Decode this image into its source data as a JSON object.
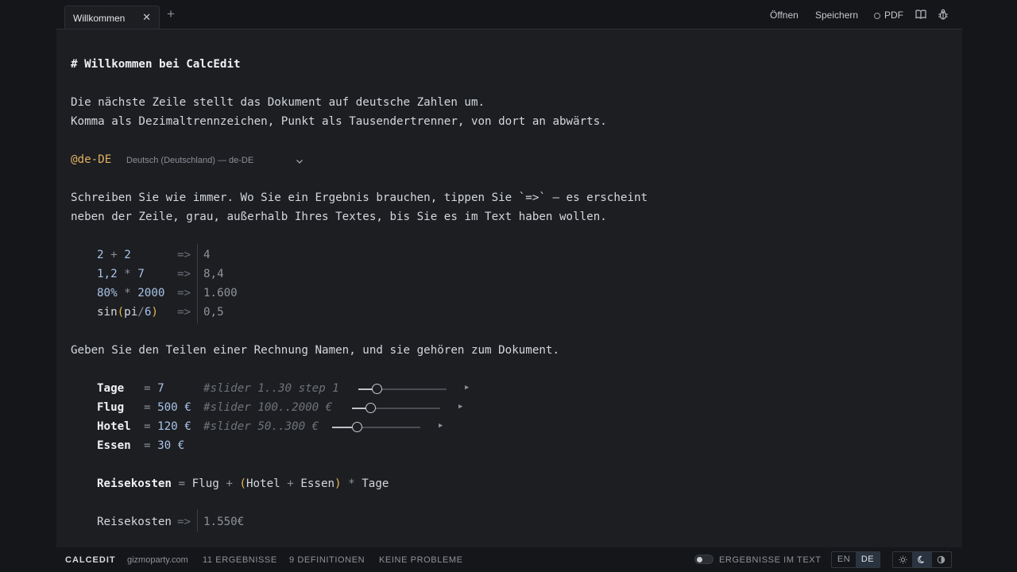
{
  "tabs": [
    {
      "label": "Willkommen",
      "active": true
    }
  ],
  "toolbar": {
    "open_label": "Öffnen",
    "save_label": "Speichern",
    "pdf_label": "PDF"
  },
  "doc": {
    "heading": "# Willkommen bei CalcEdit",
    "intro_line1": "Die nächste Zeile stellt das Dokument auf deutsche Zahlen um.",
    "intro_line2": "Komma als Dezimaltrennzeichen, Punkt als Tausendertrenner, von dort an abwärts.",
    "locale_tag": "@de-DE",
    "locale_label": "Deutsch (Deutschland) — de-DE",
    "write_line1": "Schreiben Sie wie immer. Wo Sie ein Ergebnis brauchen, tippen Sie `=>` — es erscheint",
    "write_line2": "neben der Zeile, grau, außerhalb Ihres Textes, bis Sie es im Text haben wollen.",
    "arrow": "=>",
    "calc": [
      {
        "a": "2",
        "op": "+",
        "b": "2",
        "result": "4"
      },
      {
        "a": "1,2",
        "op": "*",
        "b": "7",
        "result": "8,4"
      },
      {
        "a": "80%",
        "op": "*",
        "b": "2000",
        "result": "1.600"
      },
      {
        "fn": "sin",
        "arg1": "pi",
        "op": "/",
        "arg2": "6",
        "result": "0,5"
      }
    ],
    "names_line": "Geben Sie den Teilen einer Rechnung Namen, und sie gehören zum Dokument.",
    "defs": [
      {
        "name": "Tage",
        "value": "7",
        "comment": "#slider 1..30 step 1",
        "slider_fraction": 0.21
      },
      {
        "name": "Flug",
        "value": "500 €",
        "comment": "#slider 100..2000 €",
        "slider_fraction": 0.21
      },
      {
        "name": "Hotel",
        "value": "120 €",
        "comment": "#slider 50..300 €",
        "slider_fraction": 0.28
      },
      {
        "name": "Essen",
        "value": "30 €"
      }
    ],
    "formula": {
      "name": "Reisekosten",
      "eq": "=",
      "t1": "Flug",
      "plus1": "+",
      "open": "(",
      "t2": "Hotel",
      "plus2": "+",
      "t3": "Essen",
      "close": ")",
      "times": "*",
      "t4": "Tage"
    },
    "final": {
      "name": "Reisekosten",
      "result": "1.550€"
    }
  },
  "status": {
    "brand": "CALCEDIT",
    "site": "gizmoparty.com",
    "results": "11 ERGEBNISSE",
    "definitions": "9 DEFINITIONEN",
    "problems": "KEINE PROBLEME",
    "results_in_text": "ERGEBNISSE IM TEXT",
    "results_in_text_on": false,
    "lang_en": "EN",
    "lang_de": "DE",
    "active_lang": "DE",
    "active_theme": "dark"
  },
  "colors": {
    "background": "#141619",
    "editor": "#1c1e22",
    "locale_accent": "#e0b060",
    "number": "#a9c3e8",
    "paren": "#e8b84d"
  }
}
